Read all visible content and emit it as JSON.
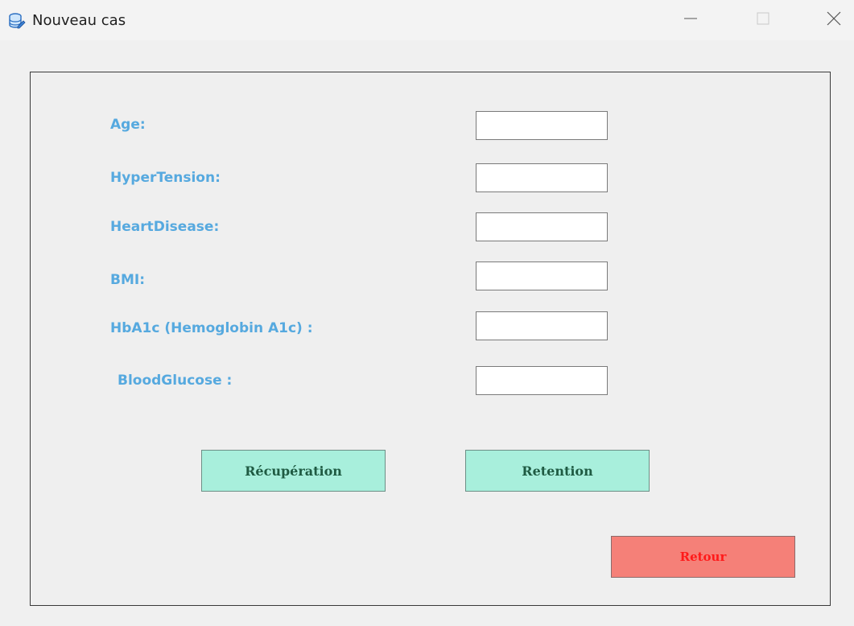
{
  "window": {
    "title": "Nouveau cas",
    "icon": "database-edit-icon",
    "controls": [
      "minimize-icon",
      "maximize-icon",
      "close-icon"
    ]
  },
  "form": {
    "fields": [
      {
        "label": "Age:",
        "value": "",
        "placeholder": ""
      },
      {
        "label": "HyperTension:",
        "value": "",
        "placeholder": ""
      },
      {
        "label": "HeartDisease:",
        "value": "",
        "placeholder": ""
      },
      {
        "label": "BMI:",
        "value": "",
        "placeholder": ""
      },
      {
        "label": "HbA1c (Hemoglobin A1c) :",
        "value": "",
        "placeholder": ""
      },
      {
        "label": "BloodGlucose :",
        "value": "",
        "placeholder": ""
      }
    ]
  },
  "buttons": {
    "recuperation": "Récupération",
    "retention": "Retention",
    "retour": "Retour"
  },
  "colors": {
    "label": "#56a9df",
    "action_button_bg": "#a8efdc",
    "action_button_text": "#1f5b43",
    "back_button_bg": "#f58078",
    "back_button_text": "#ff1a1a"
  }
}
